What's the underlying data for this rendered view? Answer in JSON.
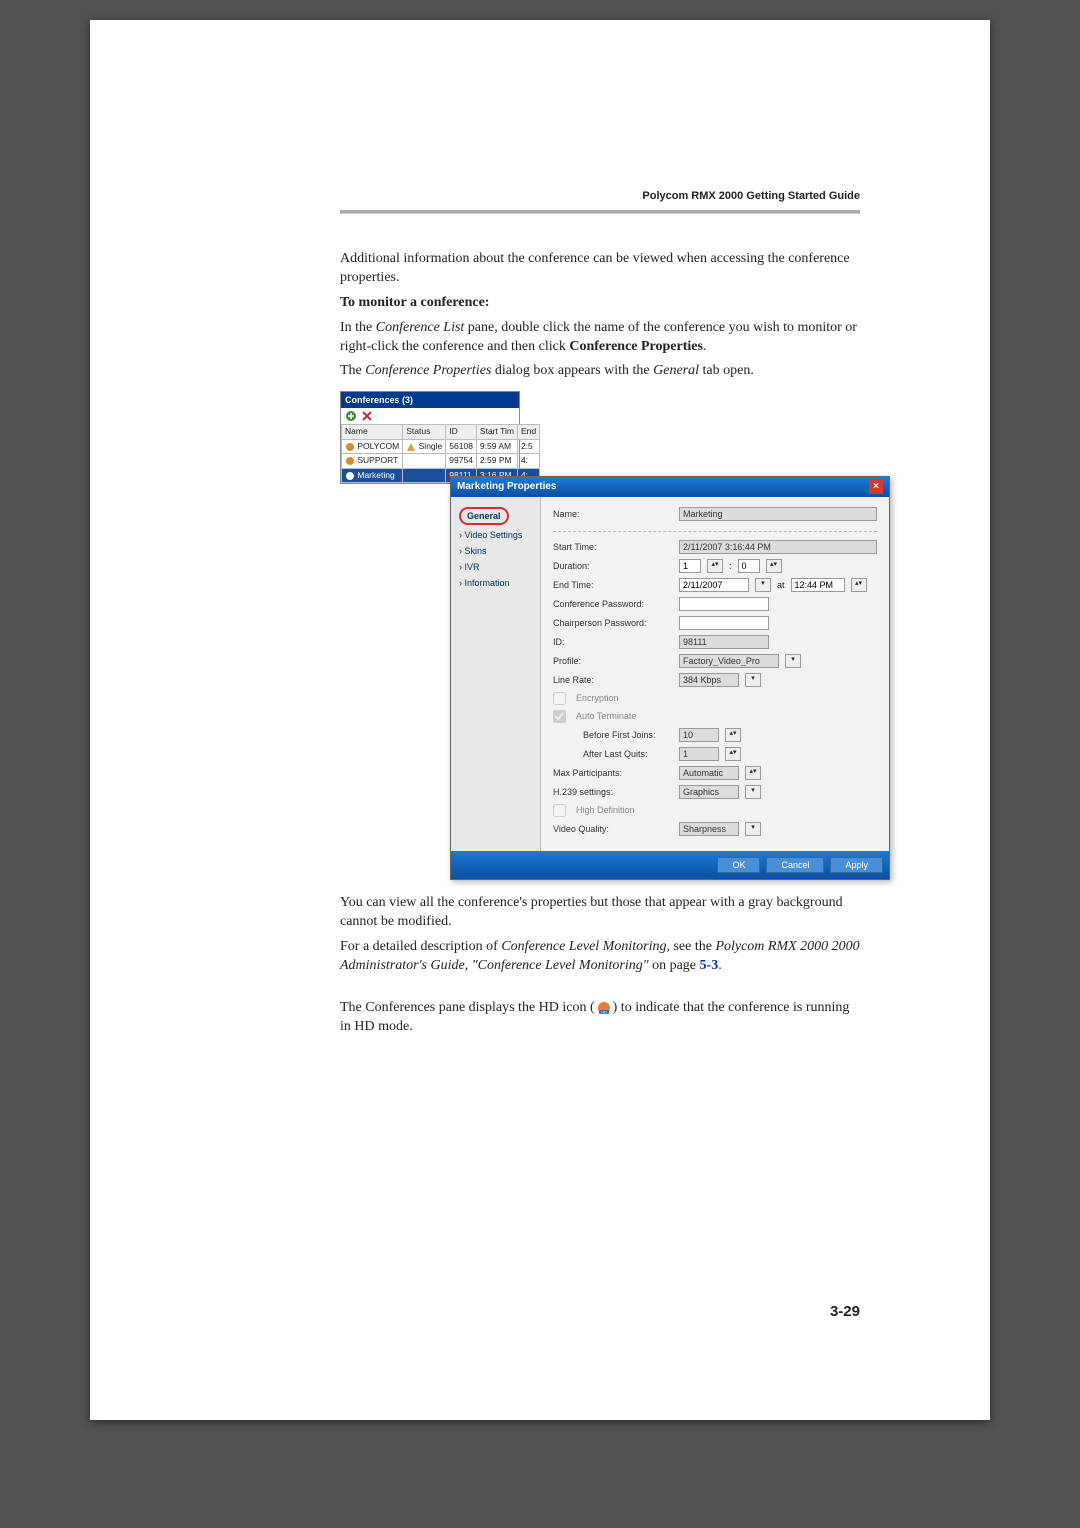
{
  "header": {
    "guide_title": "Polycom RMX 2000 Getting Started Guide"
  },
  "text": {
    "p1": "Additional information about the conference can be viewed when accessing the conference properties.",
    "subhead": "To monitor a conference:",
    "p2a": "In the ",
    "p2b": "Conference List",
    "p2c": " pane, double click the name of the conference you wish to monitor or right-click the conference and then click ",
    "p2d": "Conference Properties",
    "p2e": ".",
    "p3a": "The ",
    "p3b": "Conference Properties",
    "p3c": " dialog box appears with the ",
    "p3d": "General",
    "p3e": " tab open.",
    "p4": "You can view all the conference's properties but those that appear with a gray background cannot be modified.",
    "p5a": "For a detailed description of ",
    "p5b": "Conference Level Monitoring,",
    "p5c": " see the ",
    "p5d": "Polycom RMX 2000 2000 Administrator's Guide, \"Conference Level Monitoring\"",
    "p5e": " on page ",
    "p5link": "5-3",
    "p5f": ".",
    "p6a": "The Conferences pane displays the HD icon (",
    "p6b": ") to indicate that the conference is running in HD mode."
  },
  "conferences_pane": {
    "title": "Conferences (3)",
    "columns": [
      "Name",
      "Status",
      "ID",
      "Start Tim",
      "End"
    ],
    "rows": [
      {
        "name": "POLYCOM",
        "status": "Single",
        "id": "56108",
        "start": "9:59 AM",
        "end": "2:5"
      },
      {
        "name": "SUPPORT",
        "status": "",
        "id": "99754",
        "start": "2:59 PM",
        "end": "4:"
      },
      {
        "name": "Marketing",
        "status": "",
        "id": "98111",
        "start": "3:16 PM",
        "end": "4:"
      }
    ],
    "toolbar_icons": [
      "add-icon",
      "delete-icon"
    ]
  },
  "properties_dialog": {
    "title": "Marketing Properties",
    "nav": [
      "General",
      "Video Settings",
      "Skins",
      "IVR",
      "Information"
    ],
    "fields": {
      "name_label": "Name:",
      "name_value": "Marketing",
      "start_label": "Start Time:",
      "start_value": "2/11/2007 3:16:44 PM",
      "duration_label": "Duration:",
      "duration_h": "1",
      "duration_m": "0",
      "end_label": "End Time:",
      "end_date": "2/11/2007",
      "end_at": "at",
      "end_time": "12:44 PM",
      "conf_pw_label": "Conference Password:",
      "chair_pw_label": "Chairperson Password:",
      "id_label": "ID:",
      "id_value": "98111",
      "profile_label": "Profile:",
      "profile_value": "Factory_Video_Pro",
      "linerate_label": "Line Rate:",
      "linerate_value": "384 Kbps",
      "encryption_label": "Encryption",
      "autoterm_label": "Auto Terminate",
      "before_label": "Before First Joins:",
      "before_value": "10",
      "after_label": "After Last Quits:",
      "after_value": "1",
      "maxpart_label": "Max Participants:",
      "maxpart_value": "Automatic",
      "h239_label": "H.239 settings:",
      "h239_value": "Graphics",
      "hd_label": "High Definition",
      "vq_label": "Video Quality:",
      "vq_value": "Sharpness"
    },
    "buttons": {
      "ok": "OK",
      "cancel": "Cancel",
      "apply": "Apply"
    }
  },
  "page_number": "3-29"
}
